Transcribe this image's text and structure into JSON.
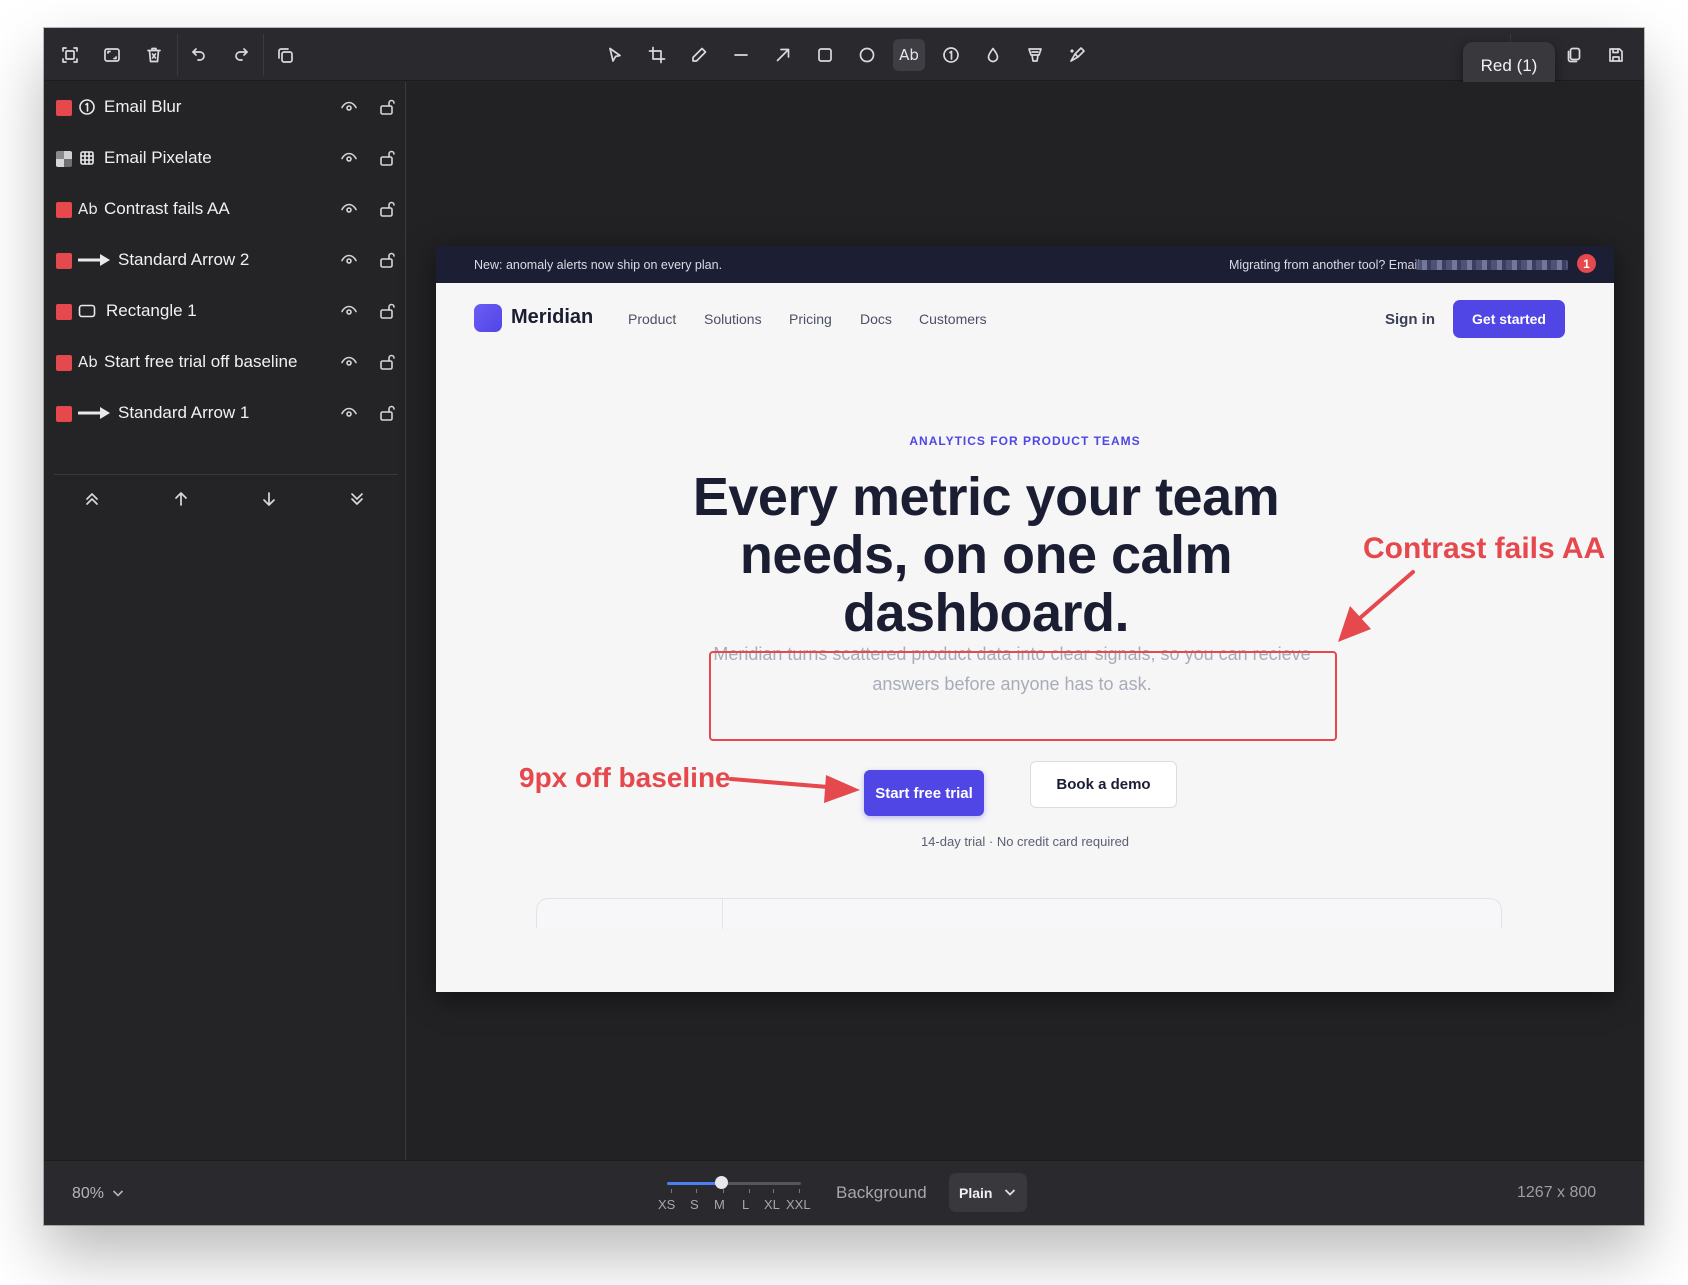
{
  "toolbar": {
    "left_icons": [
      "capture-area-icon",
      "capture-window-icon",
      "trash-icon",
      "undo-icon",
      "redo-icon",
      "copy-layers-icon"
    ],
    "tools": [
      "select-icon",
      "crop-icon",
      "pencil-icon",
      "line-icon",
      "arrow-icon",
      "rectangle-icon",
      "ellipse-icon",
      "text-icon",
      "counter-icon",
      "blur-drop-icon",
      "highlighter-icon",
      "pixelate-brush-icon"
    ],
    "active_tool_label": "Ab",
    "right_icons": [
      "duplicate-icon",
      "save-icon"
    ],
    "tooltip": "Red (1)"
  },
  "layers": [
    {
      "name": "Email Blur",
      "icon": "counter-icon",
      "swatch": "#e5484d"
    },
    {
      "name": "Email Pixelate",
      "icon": "pixelate-icon",
      "swatch": "pixelated"
    },
    {
      "name": "Contrast fails AA",
      "icon": "text-icon",
      "icon_text": "Ab",
      "swatch": "#e5484d"
    },
    {
      "name": "Standard Arrow 2",
      "icon": "arrow-icon",
      "swatch": "#e5484d"
    },
    {
      "name": "Rectangle 1",
      "icon": "rectangle-icon",
      "swatch": "#e5484d"
    },
    {
      "name": "Start free trial off baseline",
      "icon": "text-icon",
      "icon_text": "Ab",
      "swatch": "#e5484d"
    },
    {
      "name": "Standard Arrow 1",
      "icon": "arrow-icon",
      "swatch": "#e5484d"
    }
  ],
  "layer_order_controls": [
    "bring-to-front-icon",
    "move-up-icon",
    "move-down-icon",
    "send-to-back-icon"
  ],
  "screenshot": {
    "banner": {
      "left_text": "New: anomaly alerts now ship on every plan.",
      "right_text": "Migrating from another tool? Email",
      "badge": "1"
    },
    "nav": {
      "brand": "Meridian",
      "links": [
        "Product",
        "Solutions",
        "Pricing",
        "Docs",
        "Customers"
      ],
      "sign_in": "Sign in",
      "cta": "Get started"
    },
    "hero": {
      "eyebrow": "ANALYTICS FOR PRODUCT TEAMS",
      "headline": "Every metric your team needs, on one calm dashboard.",
      "subtext": "Meridian turns scattered product data into clear signals, so you can recieve answers before anyone has to ask.",
      "primary_cta": "Start free trial",
      "secondary_cta": "Book a demo",
      "note": "14-day trial · No credit card required"
    }
  },
  "annotations": {
    "contrast_label": "Contrast fails AA",
    "baseline_label": "9px off baseline",
    "color": "#e5484d"
  },
  "bottom": {
    "zoom": "80%",
    "size_labels": [
      "XS",
      "S",
      "M",
      "L",
      "XL",
      "XXL"
    ],
    "size_selected": "M",
    "size_selected_fraction": 0.4,
    "background_label": "Background",
    "background_value": "Plain",
    "dimensions": "1267 x 800"
  }
}
